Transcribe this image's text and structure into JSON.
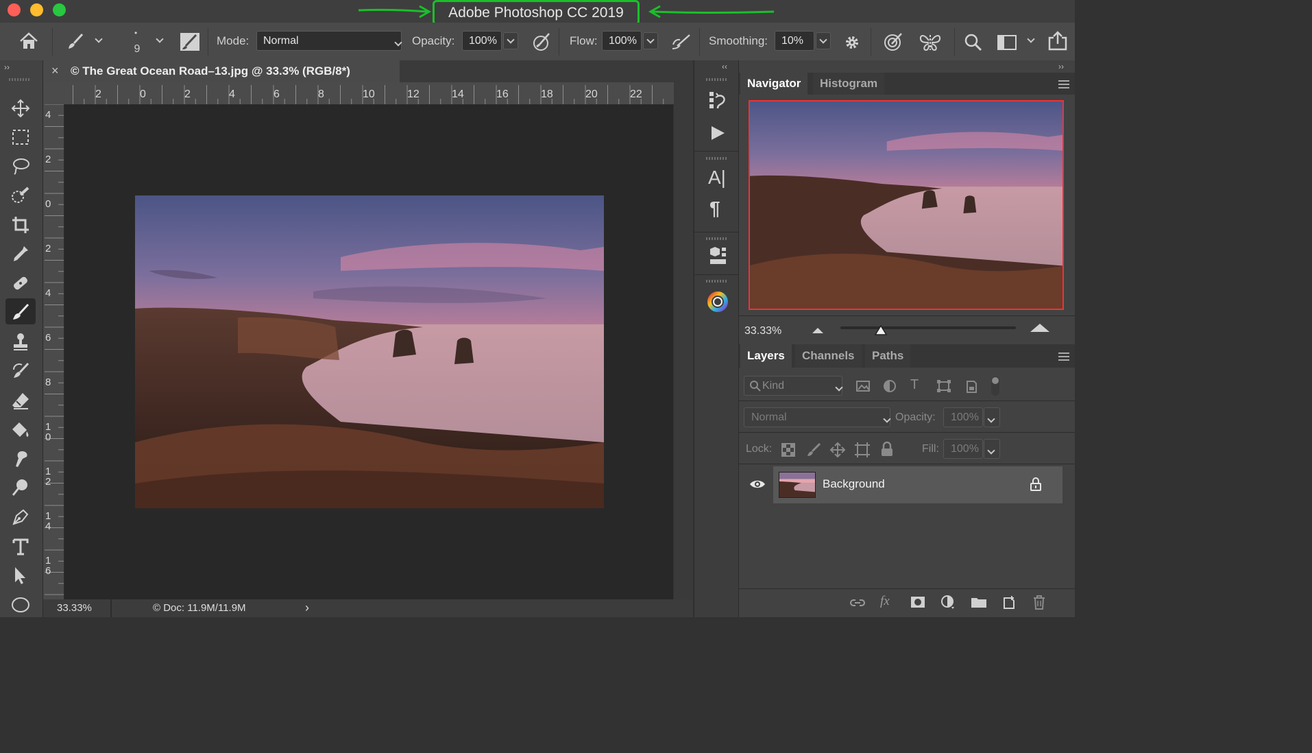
{
  "window": {
    "title": "Adobe Photoshop CC 2019",
    "traffic_lights": [
      "#fe5f57",
      "#febc2e",
      "#28c840"
    ],
    "annotation_color": "#1bbf2a"
  },
  "options_bar": {
    "brush_size": "9",
    "mode_label": "Mode:",
    "mode_value": "Normal",
    "opacity_label": "Opacity:",
    "opacity_value": "100%",
    "flow_label": "Flow:",
    "flow_value": "100%",
    "smoothing_label": "Smoothing:",
    "smoothing_value": "10%"
  },
  "tools": [
    "move-icon",
    "marquee-icon",
    "lasso-icon",
    "quick-select-icon",
    "crop-icon",
    "eyedropper-icon",
    "healing-icon",
    "brush-icon",
    "stamp-icon",
    "history-brush-icon",
    "eraser-icon",
    "paint-bucket-icon",
    "smudge-icon",
    "dodge-icon",
    "pen-icon",
    "type-icon",
    "path-select-icon",
    "ellipse-icon"
  ],
  "document": {
    "tab_title": "© The Great Ocean Road–13.jpg @ 33.3% (RGB/8*)",
    "h_ruler": [
      "2",
      "0",
      "2",
      "4",
      "6",
      "8",
      "10",
      "12",
      "14",
      "16",
      "18",
      "20",
      "22",
      "2"
    ],
    "v_ruler": [
      "4",
      "2",
      "0",
      "2",
      "4",
      "6",
      "8",
      "1\n0",
      "1\n2",
      "1\n4",
      "1\n6"
    ],
    "status_zoom": "33.33%",
    "status_doc": "© Doc: 11.9M/11.9M"
  },
  "navigator": {
    "tabs": [
      "Navigator",
      "Histogram"
    ],
    "zoom": "33.33%",
    "slider_position": 0.23
  },
  "layers": {
    "tabs": [
      "Layers",
      "Channels",
      "Paths"
    ],
    "filter_kind": "Kind",
    "blend_mode": "Normal",
    "opacity_label": "Opacity:",
    "opacity_value": "100%",
    "lock_label": "Lock:",
    "fill_label": "Fill:",
    "fill_value": "100%",
    "items": [
      {
        "name": "Background",
        "visible": true,
        "locked": true
      }
    ]
  }
}
